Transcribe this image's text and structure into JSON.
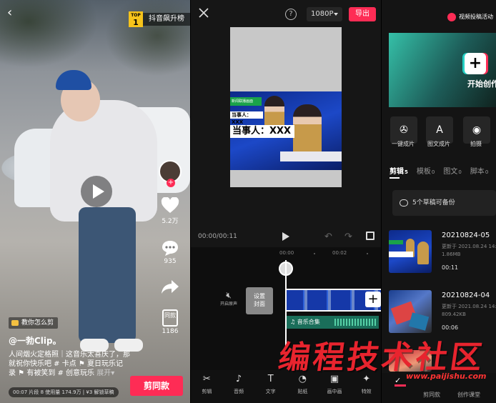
{
  "feed": {
    "rank_badge": {
      "top_label": "TOP",
      "top_number": "1",
      "text": "抖音飙升榜"
    },
    "side": {
      "likes": "5.2万",
      "comments": "935",
      "tongkuan_label": "同款",
      "tongkuan_count": "1186"
    },
    "teach_label": "教你怎么剪",
    "author": "@一勃Clip。",
    "caption": "人间烟火定格照｜这音乐太喜庆了，那就祝你快乐吧 # 卡点 ⚑ 夏日玩乐记录 ⚑ 有被笑到 # 创意玩乐",
    "caption_more": "展开▾",
    "stat_bar": "00:07 片段 8 使用量 174.9万 | ¥3 解锁草稿",
    "same_button": "剪同款"
  },
  "editor": {
    "resolution": "1080P",
    "export_label": "导出",
    "help_label": "?",
    "news": {
      "tag": "新闻联播画面",
      "sub1": "当事人：XXX",
      "sub2": "当事人：XXX"
    },
    "time": "00:00/00:11",
    "ticks": [
      "00:00",
      "00:02"
    ],
    "mute_label": "开启原声",
    "cover_label": "设置\n封面",
    "audio_label": "音乐合集",
    "tools": [
      {
        "icon": "scissors-icon",
        "glyph": "✂",
        "label": "剪辑"
      },
      {
        "icon": "music-icon",
        "glyph": "♪",
        "label": "音频"
      },
      {
        "icon": "text-icon",
        "glyph": "T",
        "label": "文字"
      },
      {
        "icon": "sticker-icon",
        "glyph": "◔",
        "label": "贴纸"
      },
      {
        "icon": "pip-icon",
        "glyph": "▣",
        "label": "画中画"
      },
      {
        "icon": "effects-icon",
        "glyph": "✦",
        "label": "特效"
      }
    ]
  },
  "home": {
    "promo": "视频投稿活动",
    "start_label": "开始创作",
    "quick": [
      {
        "icon": "film-reel-icon",
        "glyph": "✇",
        "label": "一键成片"
      },
      {
        "icon": "image-text-icon",
        "glyph": "A",
        "label": "图文成片"
      },
      {
        "icon": "camera-icon",
        "glyph": "◉",
        "label": "拍摄"
      }
    ],
    "tabs": [
      {
        "label": "剪辑",
        "count": "5"
      },
      {
        "label": "模板",
        "count": "0"
      },
      {
        "label": "图文",
        "count": "0"
      },
      {
        "label": "脚本",
        "count": "0"
      }
    ],
    "backup": "5个草稿可备份",
    "drafts": [
      {
        "title": "20210824-05",
        "updated": "更新于 2021.08.24 14:5",
        "size": "1.86MB",
        "duration": "00:11"
      },
      {
        "title": "20210824-04",
        "updated": "更新于 2021.08.24 14:4",
        "size": "809.42KB",
        "duration": "00:06"
      }
    ],
    "nav": [
      "剪同款",
      "创作课堂"
    ]
  },
  "watermark": {
    "text": "编程技术社区",
    "url": "www.paijishu.com"
  },
  "colors": {
    "accent": "#fe2c55",
    "gold": "#f6c31b"
  }
}
